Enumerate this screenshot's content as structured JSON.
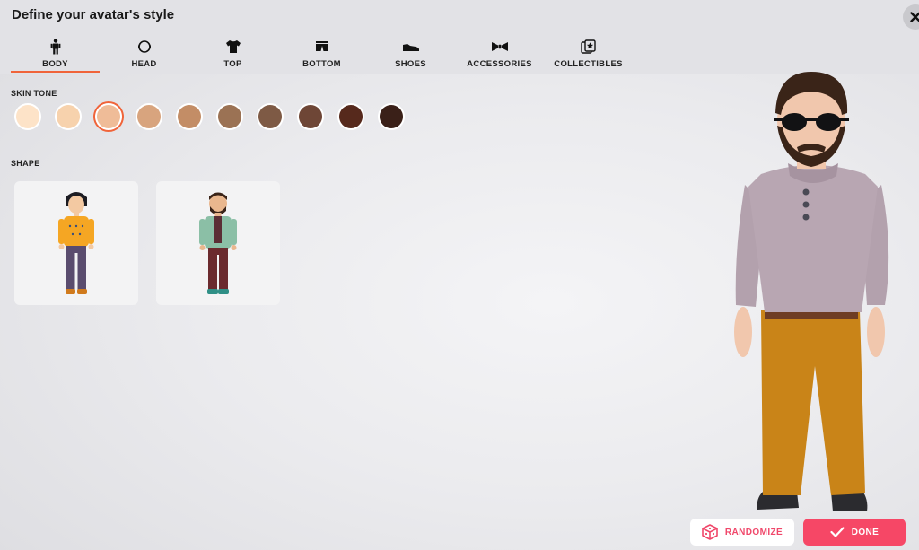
{
  "header": {
    "title": "Define your avatar's style"
  },
  "tabs": [
    {
      "label": "BODY",
      "icon": "body-icon",
      "active": true
    },
    {
      "label": "HEAD",
      "icon": "head-icon",
      "active": false
    },
    {
      "label": "TOP",
      "icon": "shirt-icon",
      "active": false
    },
    {
      "label": "BOTTOM",
      "icon": "shorts-icon",
      "active": false
    },
    {
      "label": "SHOES",
      "icon": "shoe-icon",
      "active": false
    },
    {
      "label": "ACCESSORIES",
      "icon": "bowtie-icon",
      "active": false
    },
    {
      "label": "COLLECTIBLES",
      "icon": "star-cards-icon",
      "active": false
    }
  ],
  "skin_tone": {
    "label": "SKIN TONE",
    "selected_index": 2,
    "swatches": [
      "#fde3c8",
      "#f7d2ad",
      "#efbc98",
      "#d8a47e",
      "#c38d66",
      "#9b7254",
      "#7e5a45",
      "#6e4636",
      "#56291c",
      "#3a2018"
    ]
  },
  "shape": {
    "label": "SHAPE"
  },
  "actions": {
    "randomize_label": "RANDOMIZE",
    "done_label": "DONE"
  },
  "colors": {
    "accent": "#f0643a",
    "done_bg": "#f64766",
    "randomize_text": "#f0476a"
  }
}
